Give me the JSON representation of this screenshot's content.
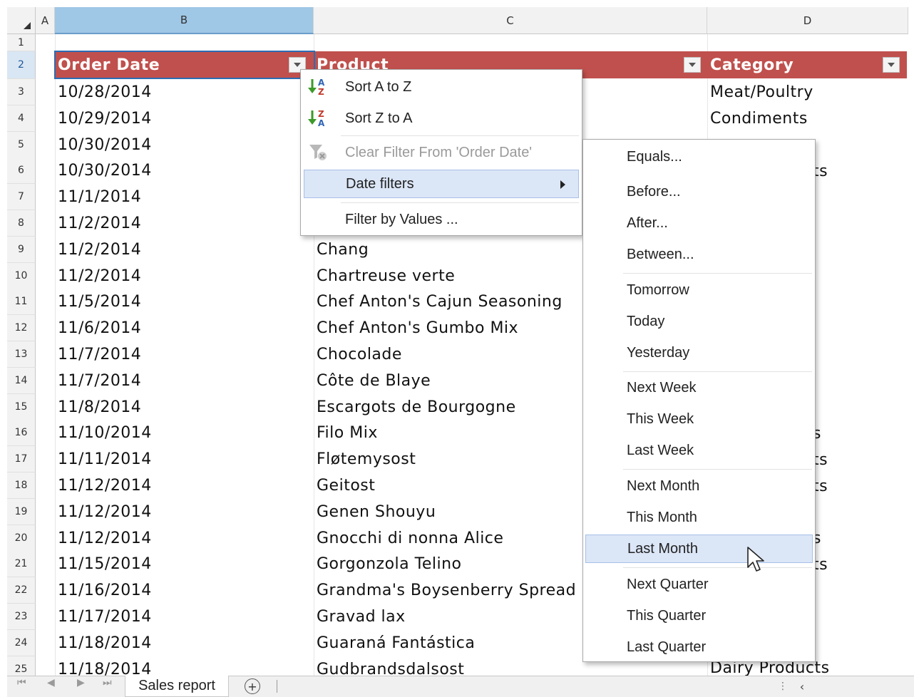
{
  "columns": [
    {
      "label": "A"
    },
    {
      "label": "B"
    },
    {
      "label": "C"
    },
    {
      "label": "D"
    }
  ],
  "rows": [
    "1",
    "2",
    "3",
    "4",
    "5",
    "6",
    "7",
    "8",
    "9",
    "10",
    "11",
    "12",
    "13",
    "14",
    "15",
    "16",
    "17",
    "18",
    "19",
    "20",
    "21",
    "22",
    "23",
    "24",
    "25"
  ],
  "table_headers": {
    "order_date": "Order Date",
    "product": "Product",
    "category": "Category"
  },
  "order_dates": [
    "10/28/2014",
    "10/29/2014",
    "10/30/2014",
    "10/30/2014",
    "11/1/2014",
    "11/2/2014",
    "11/2/2014",
    "11/2/2014",
    "11/5/2014",
    "11/6/2014",
    "11/7/2014",
    "11/7/2014",
    "11/8/2014",
    "11/10/2014",
    "11/11/2014",
    "11/12/2014",
    "11/12/2014",
    "11/12/2014",
    "11/15/2014",
    "11/16/2014",
    "11/17/2014",
    "11/18/2014",
    "11/18/2014"
  ],
  "products": [
    "Chang",
    "Chartreuse verte",
    "Chef Anton's Cajun Seasoning",
    "Chef Anton's Gumbo Mix",
    "Chocolade",
    "Côte de Blaye",
    "Escargots de Bourgogne",
    "Filo Mix",
    "Fløtemysost",
    "Geitost",
    "Genen Shouyu",
    "Gnocchi di nonna Alice",
    "Gorgonzola Telino",
    "Grandma's Boysenberry Spread",
    "Gravad lax",
    "Guaraná Fantástica",
    "Gudbrandsdalsost"
  ],
  "categories_visible": {
    "row3": "Meat/Poultry",
    "row4": "Condiments",
    "row25": "Dairy Products"
  },
  "category_fragments": [
    "ts",
    "s",
    "ts",
    "ts",
    "s",
    "ts"
  ],
  "filter_menu": {
    "items": [
      {
        "label": "Sort A to Z",
        "icon": "sort-ascending-icon"
      },
      {
        "label": "Sort Z to A",
        "icon": "sort-descending-icon"
      },
      {
        "label": "Clear Filter From 'Order Date'",
        "icon": "clear-filter-icon",
        "disabled": true
      },
      {
        "label": "Date filters",
        "icon": "submenu-arrow-icon"
      },
      {
        "label": "Filter by Values ..."
      }
    ]
  },
  "date_filter_menu": {
    "items": [
      "Equals...",
      "Before...",
      "After...",
      "Between...",
      "Tomorrow",
      "Today",
      "Yesterday",
      "Next Week",
      "This Week",
      "Last Week",
      "Next Month",
      "This Month",
      "Last Month",
      "Next Quarter",
      "This Quarter",
      "Last Quarter"
    ],
    "highlighted": "Last Month"
  },
  "sheet_tabs": {
    "active": "Sales report",
    "add_icon": "add-sheet-icon"
  },
  "colors": {
    "table_header_bg": "#c0504d",
    "selected_col_header": "#9fc7e6",
    "menu_highlight": "#dbe6f7"
  }
}
